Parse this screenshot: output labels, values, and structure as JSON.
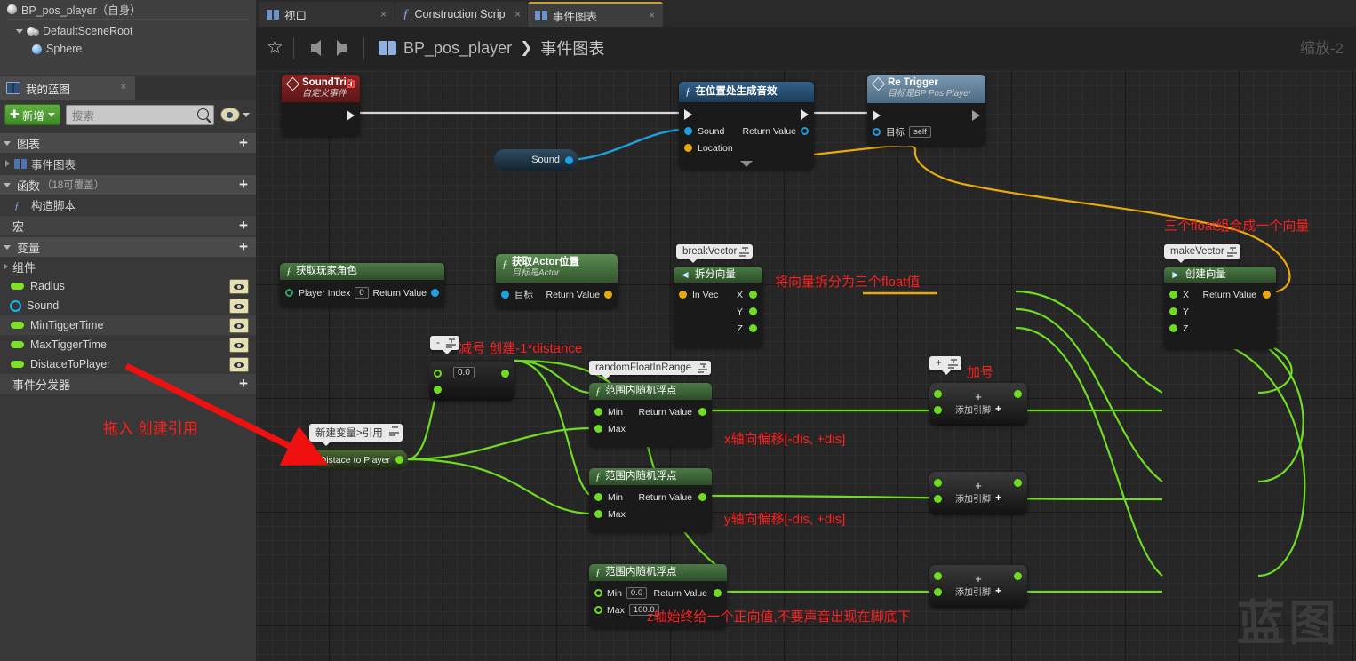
{
  "outliner": {
    "root": "BP_pos_player（自身）",
    "items": [
      {
        "label": "DefaultSceneRoot"
      },
      {
        "label": "Sphere"
      }
    ]
  },
  "myblueprint": {
    "tab_label": "我的蓝图",
    "add_button": "新增",
    "search_placeholder": "搜索",
    "sections": [
      {
        "title": "图表",
        "sub": "",
        "plus": "+"
      },
      {
        "title": "函数",
        "sub": "（18可覆盖）",
        "plus": "+"
      },
      {
        "title": "宏",
        "sub": "",
        "plus": "+"
      },
      {
        "title": "变量",
        "sub": "",
        "plus": "+"
      },
      {
        "title": "事件分发器",
        "sub": "",
        "plus": "+"
      }
    ],
    "graph_item": "事件图表",
    "function_item": "构造脚本",
    "components_header": "组件",
    "variables": [
      {
        "name": "Radius",
        "type": "float"
      },
      {
        "name": "Sound",
        "type": "object"
      },
      {
        "name": "MinTiggerTime",
        "type": "float"
      },
      {
        "name": "MaxTiggerTime",
        "type": "float"
      },
      {
        "name": "DistaceToPlayer",
        "type": "float"
      }
    ]
  },
  "tabs": [
    {
      "label": "视口",
      "icon": "blueprint-icon",
      "selected": false,
      "close": "×"
    },
    {
      "label": "Construction Scrip",
      "icon": "function-icon",
      "selected": false,
      "close": "×"
    },
    {
      "label": "事件图表",
      "icon": "blueprint-icon",
      "selected": true,
      "close": "×"
    }
  ],
  "breadcrumb": {
    "root": "BP_pos_player",
    "chevron": "❯",
    "leaf": "事件图表"
  },
  "zoom_label": "缩放-2",
  "watermark": "蓝图",
  "nodes": {
    "sound_trig": {
      "title": "SoundTrig",
      "subtitle": "自定义事件"
    },
    "spawn_sound": {
      "title": "在位置处生成音效",
      "pins": [
        "Sound",
        "Location"
      ],
      "out": "Return Value"
    },
    "re_trigger": {
      "title": "Re Trigger",
      "subtitle": "目标是BP Pos Player",
      "target_label": "目标",
      "target_value": "self"
    },
    "sound_reroute": {
      "label": "Sound"
    },
    "get_player_character": {
      "title": "获取玩家角色",
      "in_label": "Player Index",
      "in_value": "0",
      "out": "Return Value"
    },
    "get_actor_location": {
      "title": "获取Actor位置",
      "subtitle": "目标是Actor",
      "in_label": "目标",
      "out": "Return Value"
    },
    "break_vector": {
      "bubble": "breakVector",
      "title": "拆分向量",
      "in_label": "In Vec",
      "outs": [
        "X",
        "Y",
        "Z"
      ]
    },
    "make_vector": {
      "bubble": "makeVector",
      "title": "创建向量",
      "ins": [
        "X",
        "Y",
        "Z"
      ],
      "out": "Return Value"
    },
    "negate": {
      "bubble": "-",
      "value": "0.0"
    },
    "distance_var": {
      "bubble": "新建变量>引用",
      "label": "Distace to Player"
    },
    "random_x": {
      "bubble": "randomFloatInRange",
      "title": "范围内随机浮点",
      "min": "Min",
      "max": "Max",
      "out": "Return Value"
    },
    "random_y": {
      "title": "范围内随机浮点",
      "min": "Min",
      "max": "Max",
      "out": "Return Value"
    },
    "random_z": {
      "title": "范围内随机浮点",
      "min": "Min",
      "min_value": "0.0",
      "max": "Max",
      "max_value": "100.0",
      "out": "Return Value"
    },
    "add_nodes": {
      "bubble": "+",
      "symbol": "+",
      "add_pin": "添加引脚",
      "add_pin_plus": "+"
    }
  },
  "annotations": [
    {
      "id": "make-vector-note",
      "text": "三个float组合成一个向量"
    },
    {
      "id": "break-vector-note",
      "text": "将向量拆分为三个float值"
    },
    {
      "id": "negate-note",
      "text": "减号 创建-1*distance"
    },
    {
      "id": "plus-note",
      "text": "加号"
    },
    {
      "id": "drag-note",
      "text": "拖入 创建引用"
    },
    {
      "id": "x-offset-note",
      "text": "x轴向偏移[-dis, +dis]"
    },
    {
      "id": "y-offset-note",
      "text": "y轴向偏移[-dis, +dis]"
    },
    {
      "id": "z-offset-note",
      "text": "z轴始终给一个正向值,不要声音出现在脚底下"
    }
  ],
  "colors": {
    "exec_wire": "#d8d8d8",
    "object_wire": "#1e9fe0",
    "vector_wire": "#e8a90c",
    "float_wire": "#6fdc23",
    "accent_green": "#5fae3f",
    "annotation_red": "#ff1f1f",
    "tab_highlight": "#c9a227"
  }
}
